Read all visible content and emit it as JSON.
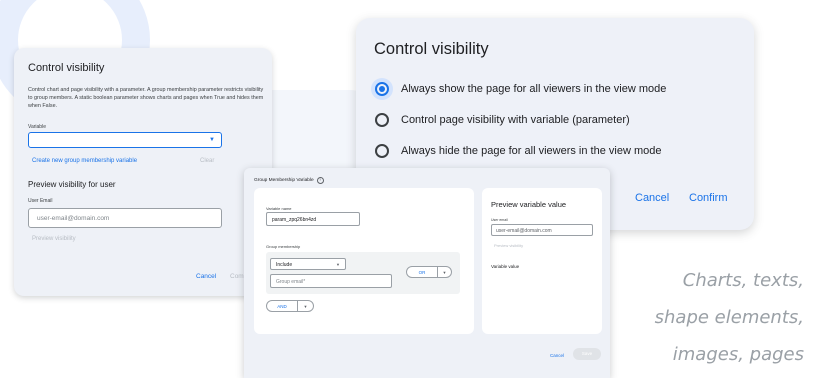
{
  "dialog_left": {
    "title": "Control visibility",
    "description": "Control chart and page visibility with a parameter. A group membership parameter restricts visibility to group members. A static boolean parameter shows charts and pages when True and hides them when False.",
    "variable_label": "Variable",
    "create_link": "Create new group membership variable",
    "clear_link": "Clear",
    "preview_title": "Preview visibility for user",
    "user_email_label": "User Email",
    "user_email_placeholder": "user-email@domain.com",
    "preview_link": "Preview visibility",
    "cancel_label": "Cancel",
    "confirm_label": "Com"
  },
  "dialog_right": {
    "title": "Control visibility",
    "options": [
      {
        "label": "Always show the page for all viewers in the view mode",
        "checked": true
      },
      {
        "label": "Control page visibility with variable (parameter)",
        "checked": false
      },
      {
        "label": "Always hide the page for all viewers in the view mode",
        "checked": false
      }
    ],
    "cancel_label": "Cancel",
    "confirm_label": "Confirm"
  },
  "dialog_group": {
    "title": "Group Membership Variable",
    "help_icon": "help-circle-icon",
    "variable_name_label": "Variable name",
    "variable_name_value": "param_zpq26bn4zd",
    "group_membership_label": "Group membership",
    "include_value": "Include",
    "group_email_placeholder": "Group email*",
    "or_label": "OR",
    "and_label": "AND",
    "preview_title": "Preview variable value",
    "preview_user_email_label": "User email",
    "preview_user_email_value": "user-email@domain.com",
    "preview_link": "Preview visibility",
    "variable_value_label": "Variable value",
    "cancel_label": "Cancel",
    "save_label": "Save"
  },
  "side_caption": {
    "line1": "Charts, texts,",
    "line2": "shape elements,",
    "line3": "images, pages"
  },
  "colors": {
    "accent": "#1a73e8",
    "dialog_bg": "#eef1f7",
    "muted_text": "#9aa0a6"
  }
}
